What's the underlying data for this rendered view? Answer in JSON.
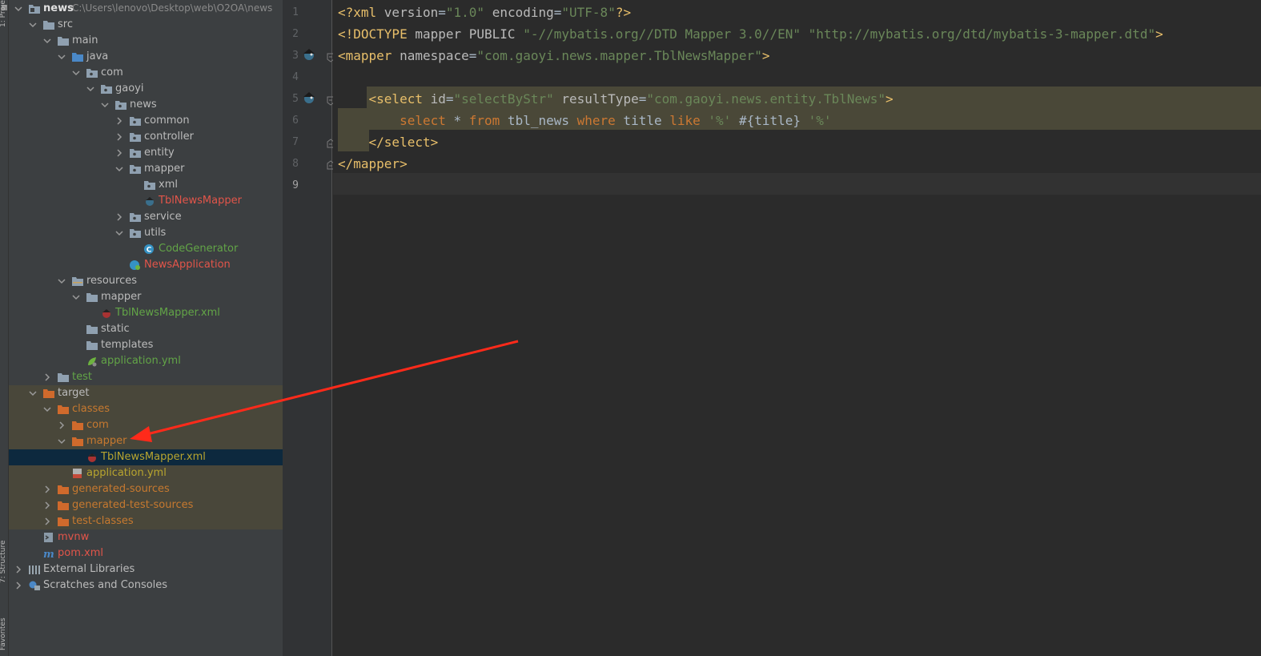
{
  "sidebar": {
    "project_label": "1: Project",
    "structure_label": "7: Structure",
    "favorites_label": "Favorites"
  },
  "tree": {
    "root": {
      "name": "news",
      "path": "C:\\Users\\lenovo\\Desktop\\web\\O2OA\\news"
    },
    "items": [
      {
        "label": "src"
      },
      {
        "label": "main"
      },
      {
        "label": "java"
      },
      {
        "label": "com"
      },
      {
        "label": "gaoyi"
      },
      {
        "label": "news"
      },
      {
        "label": "common"
      },
      {
        "label": "controller"
      },
      {
        "label": "entity"
      },
      {
        "label": "mapper"
      },
      {
        "label": "xml"
      },
      {
        "label": "TblNewsMapper"
      },
      {
        "label": "service"
      },
      {
        "label": "utils"
      },
      {
        "label": "CodeGenerator"
      },
      {
        "label": "NewsApplication"
      },
      {
        "label": "resources"
      },
      {
        "label": "mapper"
      },
      {
        "label": "TblNewsMapper.xml"
      },
      {
        "label": "static"
      },
      {
        "label": "templates"
      },
      {
        "label": "application.yml"
      },
      {
        "label": "test"
      },
      {
        "label": "target"
      },
      {
        "label": "classes"
      },
      {
        "label": "com"
      },
      {
        "label": "mapper"
      },
      {
        "label": "TblNewsMapper.xml"
      },
      {
        "label": "application.yml"
      },
      {
        "label": "generated-sources"
      },
      {
        "label": "generated-test-sources"
      },
      {
        "label": "test-classes"
      },
      {
        "label": "mvnw"
      },
      {
        "label": "pom.xml"
      },
      {
        "label": "External Libraries"
      },
      {
        "label": "Scratches and Consoles"
      }
    ]
  },
  "editor": {
    "line_numbers": [
      "1",
      "2",
      "3",
      "4",
      "5",
      "6",
      "7",
      "8",
      "9"
    ],
    "lines": [
      [
        {
          "c": "tag",
          "t": "<?xml "
        },
        {
          "c": "attr",
          "t": "version"
        },
        {
          "c": "plain",
          "t": "="
        },
        {
          "c": "str",
          "t": "\"1.0\""
        },
        {
          "c": "plain",
          "t": " "
        },
        {
          "c": "attr",
          "t": "encoding"
        },
        {
          "c": "plain",
          "t": "="
        },
        {
          "c": "str",
          "t": "\"UTF-8\""
        },
        {
          "c": "tag",
          "t": "?>"
        }
      ],
      [
        {
          "c": "tag",
          "t": "<!DOCTYPE "
        },
        {
          "c": "attr",
          "t": "mapper PUBLIC "
        },
        {
          "c": "str",
          "t": "\"-//mybatis.org//DTD Mapper 3.0//EN\""
        },
        {
          "c": "plain",
          "t": " "
        },
        {
          "c": "str",
          "t": "\"http://mybatis.org/dtd/mybatis-3-mapper.dtd\""
        },
        {
          "c": "tag",
          "t": ">"
        }
      ],
      [
        {
          "c": "tag",
          "t": "<mapper "
        },
        {
          "c": "attr",
          "t": "namespace"
        },
        {
          "c": "plain",
          "t": "="
        },
        {
          "c": "str",
          "t": "\"com.gaoyi.news.mapper.TblNewsMapper\""
        },
        {
          "c": "tag",
          "t": ">"
        }
      ],
      [],
      [
        {
          "c": "plain",
          "t": "    "
        },
        {
          "c": "tag",
          "t": "<select "
        },
        {
          "c": "attr",
          "t": "id"
        },
        {
          "c": "plain",
          "t": "="
        },
        {
          "c": "str",
          "t": "\"selectByStr\""
        },
        {
          "c": "plain",
          "t": " "
        },
        {
          "c": "attr",
          "t": "resultType"
        },
        {
          "c": "plain",
          "t": "="
        },
        {
          "c": "str",
          "t": "\"com.gaoyi.news.entity.TblNews\""
        },
        {
          "c": "tag",
          "t": ">"
        }
      ],
      [
        {
          "c": "plain",
          "t": "        "
        },
        {
          "c": "kw",
          "t": "select"
        },
        {
          "c": "plain",
          "t": " * "
        },
        {
          "c": "kw",
          "t": "from"
        },
        {
          "c": "plain",
          "t": " tbl_news "
        },
        {
          "c": "kw",
          "t": "where"
        },
        {
          "c": "plain",
          "t": " title "
        },
        {
          "c": "kw",
          "t": "like"
        },
        {
          "c": "plain",
          "t": " "
        },
        {
          "c": "str",
          "t": "'%'"
        },
        {
          "c": "plain",
          "t": " #{title} "
        },
        {
          "c": "str",
          "t": "'%'"
        }
      ],
      [
        {
          "c": "plain",
          "t": "    "
        },
        {
          "c": "tag",
          "t": "</select>"
        }
      ],
      [
        {
          "c": "tag",
          "t": "</mapper>"
        }
      ],
      []
    ]
  },
  "colors": {
    "background": "#2b2b2b",
    "panel": "#3c3f41",
    "excluded_highlight": "#49473a",
    "selection": "#0d293e",
    "annotation_arrow": "#ff2a1a"
  }
}
